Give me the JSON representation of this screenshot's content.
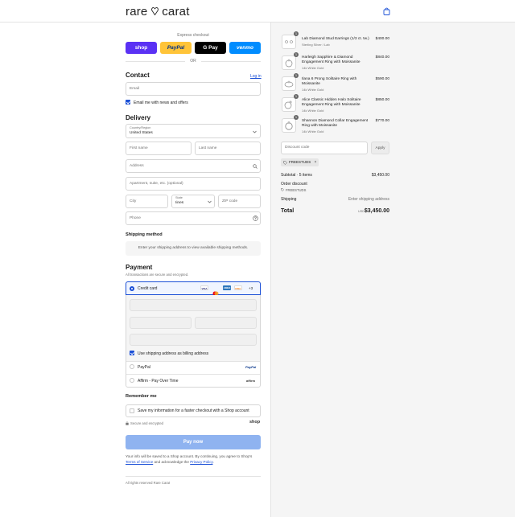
{
  "header": {
    "logo_left": "rare",
    "logo_right": "carat"
  },
  "express": {
    "title": "Express checkout",
    "shop": "shop",
    "paypal": "PayPal",
    "gpay": "G Pay",
    "venmo": "venmo",
    "or": "OR"
  },
  "contact": {
    "heading": "Contact",
    "login": "Log in",
    "email_placeholder": "Email",
    "news_label": "Email me with news and offers"
  },
  "delivery": {
    "heading": "Delivery",
    "country_label": "Country/Region",
    "country_value": "United States",
    "first_name": "First name",
    "last_name": "Last name",
    "address": "Address",
    "apartment": "Apartment, suite, etc. (optional)",
    "city": "City",
    "state_label": "State",
    "state_value": "Iines",
    "zip": "ZIP code",
    "phone": "Phone"
  },
  "shipping": {
    "heading": "Shipping method",
    "note": "Enter your shipping address to view available shipping methods."
  },
  "payment": {
    "heading": "Payment",
    "sub": "All transactions are secure and encrypted.",
    "credit_card": "Credit card",
    "card_more": "+3",
    "badges": [
      "VISA",
      "MC",
      "AMEX",
      "DISC"
    ],
    "billing_label": "Use shipping address as billing address",
    "paypal": "PayPal",
    "paypal_logo": "PayPal",
    "affirm": "Affirm - Pay Over Time",
    "affirm_logo": "affirm"
  },
  "remember": {
    "heading": "Remember me",
    "save_label": "Save my information for a faster checkout with a Shop account",
    "secure": "Secure and encrypted",
    "shop": "shop"
  },
  "pay_button": "Pay now",
  "legal": {
    "p1": "Your info will be saved to a Shop account. By continuing, you agree to Shop’s",
    "terms": "Terms of Service",
    "p2": "and acknowledge the",
    "privacy": "Privacy Policy",
    "end": "."
  },
  "footer": "All rights reserved Rare Carat",
  "summary": {
    "items": [
      {
        "qty": "1",
        "name": "Lab Diamond Stud Earrings (1/3 ct. tw.)",
        "sub": "Sterling Silver / Lab",
        "price": "$400.00"
      },
      {
        "qty": "1",
        "name": "Harleigh Sapphire & Diamond Engagement Ring with Moissanite",
        "sub": "14k White Gold",
        "price": "$840.00"
      },
      {
        "qty": "1",
        "name": "Ilana 6 Prong Solitaire Ring with Moissanite",
        "sub": "14k White Gold",
        "price": "$590.00"
      },
      {
        "qty": "1",
        "name": "Alice Classic Hidden Halo Solitaire Engagement Ring with Moissanite",
        "sub": "14k White Gold",
        "price": "$850.00"
      },
      {
        "qty": "1",
        "name": "Shannon Diamond Collar Engagement Ring with Moissanite",
        "sub": "14k White Gold",
        "price": "$770.00"
      }
    ],
    "discount_placeholder": "Discount code",
    "apply": "Apply",
    "code_tag": "FREESTUDS",
    "subtotal_label": "Subtotal · 5 items",
    "subtotal": "$3,450.00",
    "order_discount": "Order discount",
    "order_discount_code": "FREESTUDS",
    "shipping_label": "Shipping",
    "shipping_value": "Enter shipping address",
    "total_label": "Total",
    "currency": "USD",
    "total": "$3,450.00"
  }
}
